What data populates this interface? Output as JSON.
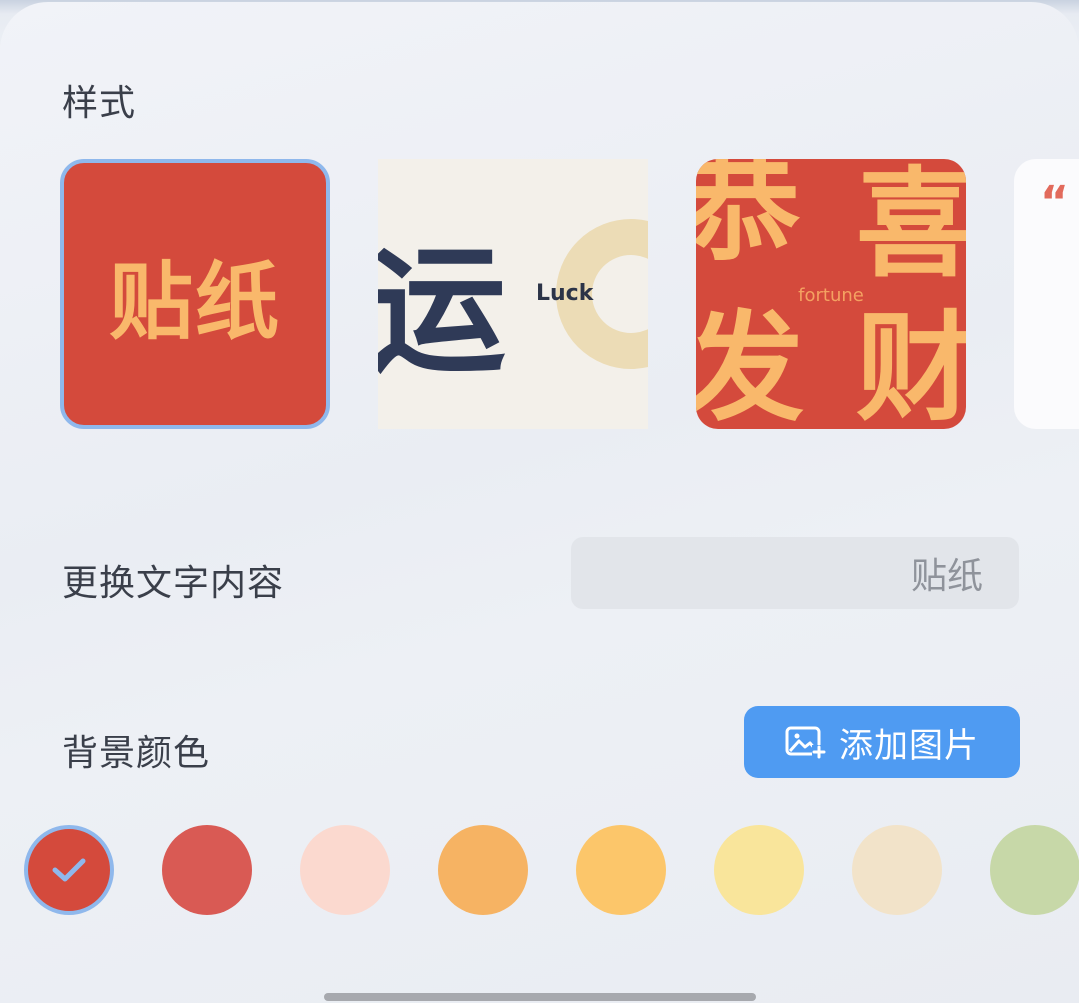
{
  "style_section": {
    "title": "样式",
    "cards": [
      {
        "name": "sticker",
        "text": "贴纸",
        "selected": true
      },
      {
        "name": "luck",
        "char": "运",
        "word": "Luck",
        "selected": false
      },
      {
        "name": "fortune",
        "chars": [
          "恭",
          "喜",
          "发",
          "财"
        ],
        "word": "fortune",
        "selected": false
      },
      {
        "name": "quote",
        "mark": "“",
        "selected": false
      }
    ]
  },
  "text_section": {
    "label": "更换文字内容",
    "input_value": "贴纸"
  },
  "background_section": {
    "label": "背景颜色",
    "add_image_label": "添加图片",
    "swatches": [
      {
        "color": "#d44a3c",
        "selected": true
      },
      {
        "color": "#d95a54",
        "selected": false
      },
      {
        "color": "#fbd9cf",
        "selected": false
      },
      {
        "color": "#f6b363",
        "selected": false
      },
      {
        "color": "#fcc66a",
        "selected": false
      },
      {
        "color": "#f9e59b",
        "selected": false
      },
      {
        "color": "#f2e3c9",
        "selected": false
      },
      {
        "color": "#c7d8a8",
        "selected": false
      }
    ]
  },
  "colors": {
    "accent_blue": "#4f9bf2",
    "selection_border": "#8fb8ec",
    "sticker_red": "#d44a3c",
    "sticker_text": "#f9b86b"
  }
}
